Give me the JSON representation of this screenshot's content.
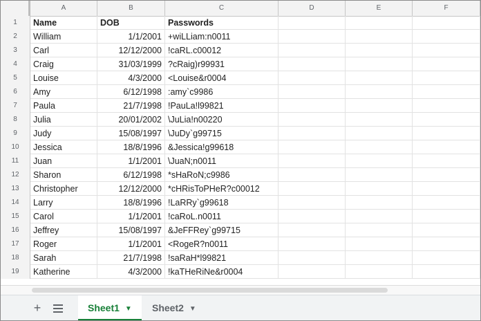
{
  "columns": [
    "A",
    "B",
    "C",
    "D",
    "E",
    "F"
  ],
  "headers": {
    "name": "Name",
    "dob": "DOB",
    "passwords": "Passwords"
  },
  "rows": [
    {
      "n": "1"
    },
    {
      "n": "2",
      "name": "William",
      "dob": "1/1/2001",
      "pw": "+wiLLiam:n0011"
    },
    {
      "n": "3",
      "name": "Carl",
      "dob": "12/12/2000",
      "pw": "!caRL.c00012"
    },
    {
      "n": "4",
      "name": "Craig",
      "dob": "31/03/1999",
      "pw": "?cRaig)r99931"
    },
    {
      "n": "5",
      "name": "Louise",
      "dob": "4/3/2000",
      "pw": "<Louise&r0004"
    },
    {
      "n": "6",
      "name": "Amy",
      "dob": "6/12/1998",
      "pw": ":amy`c9986"
    },
    {
      "n": "7",
      "name": "Paula",
      "dob": "21/7/1998",
      "pw": "!PauLa!l99821"
    },
    {
      "n": "8",
      "name": "Julia",
      "dob": "20/01/2002",
      "pw": "\\JuLia!n00220"
    },
    {
      "n": "9",
      "name": "Judy",
      "dob": "15/08/1997",
      "pw": "\\JuDy`g99715"
    },
    {
      "n": "10",
      "name": "Jessica",
      "dob": "18/8/1996",
      "pw": "&Jessica!g99618"
    },
    {
      "n": "11",
      "name": "Juan",
      "dob": "1/1/2001",
      "pw": "\\JuaN;n0011"
    },
    {
      "n": "12",
      "name": "Sharon",
      "dob": "6/12/1998",
      "pw": "*sHaRoN;c9986"
    },
    {
      "n": "13",
      "name": "Christopher",
      "dob": "12/12/2000",
      "pw": "*cHRisToPHeR?c00012"
    },
    {
      "n": "14",
      "name": "Larry",
      "dob": "18/8/1996",
      "pw": "!LaRRy`g99618"
    },
    {
      "n": "15",
      "name": "Carol",
      "dob": "1/1/2001",
      "pw": "!caRoL.n0011"
    },
    {
      "n": "16",
      "name": "Jeffrey",
      "dob": "15/08/1997",
      "pw": "&JeFFRey`g99715"
    },
    {
      "n": "17",
      "name": "Roger",
      "dob": "1/1/2001",
      "pw": "<RogeR?n0011"
    },
    {
      "n": "18",
      "name": "Sarah",
      "dob": "21/7/1998",
      "pw": "!saRaH*l99821"
    },
    {
      "n": "19",
      "name": "Katherine",
      "dob": "4/3/2000",
      "pw": "!kaTHeRiNe&r0004"
    }
  ],
  "tabs": {
    "add_icon": "plus-icon",
    "list_icon": "list-icon",
    "sheet1": "Sheet1",
    "sheet2": "Sheet2"
  }
}
